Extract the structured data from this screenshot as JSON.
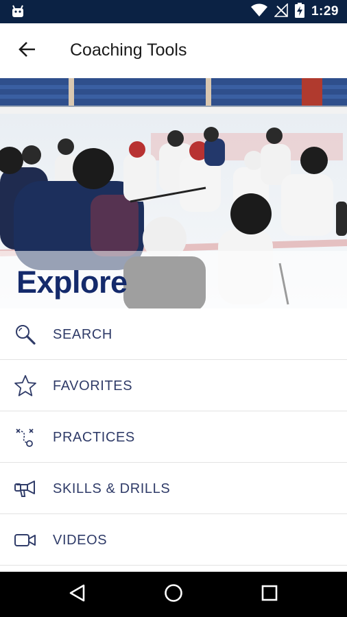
{
  "status_bar": {
    "time": "1:29",
    "icons": [
      "android-notification-icon",
      "wifi-icon",
      "no-signal-icon",
      "battery-charging-icon"
    ]
  },
  "app_bar": {
    "title": "Coaching Tools",
    "back_icon": "arrow-back-icon"
  },
  "hero": {
    "title": "Explore"
  },
  "menu": {
    "items": [
      {
        "label": "SEARCH",
        "icon": "search-icon"
      },
      {
        "label": "FAVORITES",
        "icon": "star-icon"
      },
      {
        "label": "PRACTICES",
        "icon": "play-diagram-icon"
      },
      {
        "label": "SKILLS & DRILLS",
        "icon": "whistle-icon"
      },
      {
        "label": "VIDEOS",
        "icon": "video-camera-icon"
      }
    ]
  },
  "nav_bar": {
    "buttons": [
      "back-triangle-icon",
      "home-circle-icon",
      "recents-square-icon"
    ]
  },
  "colors": {
    "status_bar": "#0b2244",
    "accent": "#142a6b",
    "menu_text": "#2f3b68",
    "divider": "#e2e2e2"
  }
}
